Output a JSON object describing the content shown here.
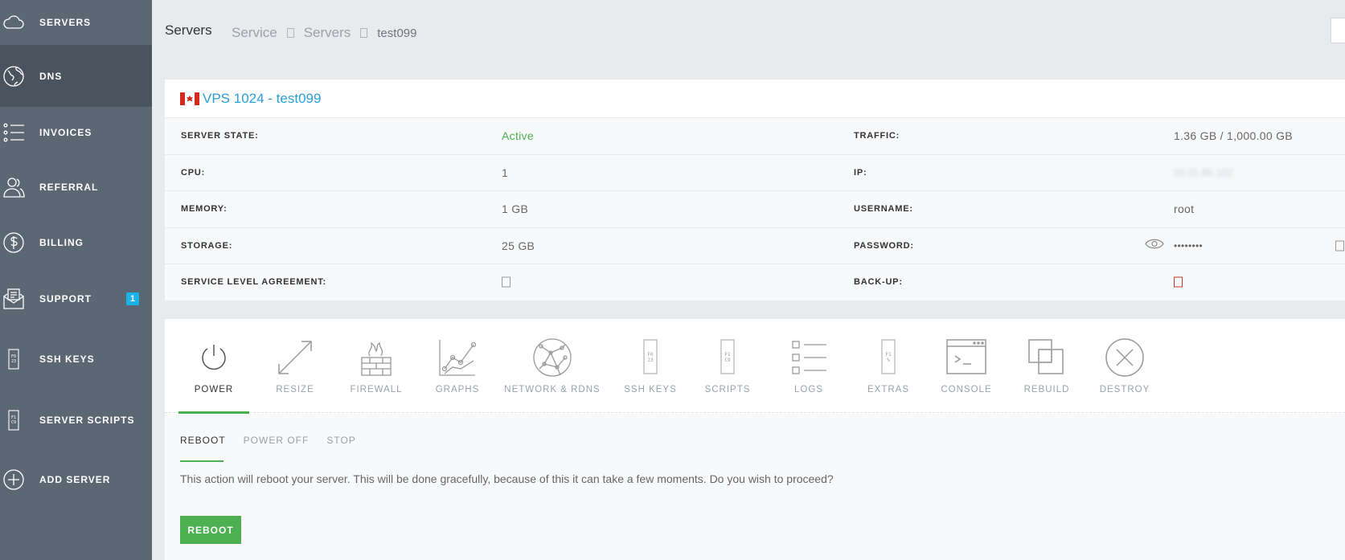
{
  "sidebar": {
    "items": [
      {
        "label": "SERVERS",
        "icon": "cloud-icon"
      },
      {
        "label": "DNS",
        "icon": "globe-icon"
      },
      {
        "label": "INVOICES",
        "icon": "list-icon"
      },
      {
        "label": "REFERRAL",
        "icon": "users-icon"
      },
      {
        "label": "BILLING",
        "icon": "dollar-icon"
      },
      {
        "label": "SUPPORT",
        "icon": "mail-icon",
        "badge": "1"
      },
      {
        "label": "SSH KEYS",
        "icon": "key-file-icon"
      },
      {
        "label": "SERVER SCRIPTS",
        "icon": "script-file-icon"
      },
      {
        "label": "ADD SERVER",
        "icon": "plus-circle-icon"
      }
    ]
  },
  "header": {
    "title": "Servers",
    "breadcrumb": [
      "Service",
      "Servers",
      "test099"
    ]
  },
  "server": {
    "name": "VPS 1024 - test099",
    "rows": [
      {
        "label": "SERVER STATE:",
        "value": "Active",
        "label2": "TRAFFIC:",
        "value2": "1.36 GB / 1,000.00 GB"
      },
      {
        "label": "CPU:",
        "value": "1",
        "label2": "IP:",
        "value2": "00.01.85.102"
      },
      {
        "label": "MEMORY:",
        "value": "1 GB",
        "label2": "USERNAME:",
        "value2": "root"
      },
      {
        "label": "STORAGE:",
        "value": "25 GB",
        "label2": "PASSWORD:",
        "value2": "••••••••"
      },
      {
        "label": "SERVICE LEVEL AGREEMENT:",
        "value": "",
        "label2": "BACK-UP:",
        "value2": ""
      }
    ]
  },
  "actions": {
    "tabs": [
      {
        "label": "POWER",
        "icon": "power-icon"
      },
      {
        "label": "RESIZE",
        "icon": "resize-icon"
      },
      {
        "label": "FIREWALL",
        "icon": "firewall-icon"
      },
      {
        "label": "GRAPHS",
        "icon": "graph-icon"
      },
      {
        "label": "NETWORK & RDNS",
        "icon": "network-icon"
      },
      {
        "label": "SSH KEYS",
        "icon": "key-file-icon"
      },
      {
        "label": "SCRIPTS",
        "icon": "script-file-icon"
      },
      {
        "label": "LOGS",
        "icon": "logs-icon"
      },
      {
        "label": "EXTRAS",
        "icon": "extras-icon"
      },
      {
        "label": "CONSOLE",
        "icon": "console-icon"
      },
      {
        "label": "REBUILD",
        "icon": "rebuild-icon"
      },
      {
        "label": "DESTROY",
        "icon": "destroy-icon"
      }
    ],
    "sub_tabs": [
      "REBOOT",
      "POWER OFF",
      "STOP"
    ],
    "description": "This action will reboot your server. This will be done gracefully, because of this it can take a few moments. Do you wish to proceed?",
    "button_label": "REBOOT"
  },
  "colors": {
    "sidebar": "#5c6774",
    "accent": "#4caf50",
    "link": "#2a9fd6",
    "badge": "#1ab3e8"
  }
}
